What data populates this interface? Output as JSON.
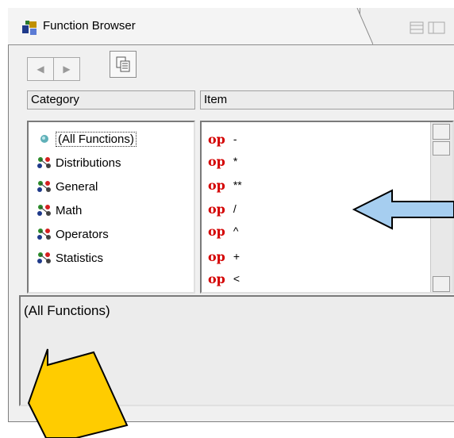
{
  "window": {
    "title": "Function Browser"
  },
  "toolbar": {
    "back_icon": "arrow-left-icon",
    "forward_icon": "arrow-right-icon",
    "copy_icon": "copy-icon"
  },
  "columns": {
    "category": "Category",
    "item": "Item"
  },
  "categories": [
    {
      "label": "(All Functions)",
      "icon": "dot-icon",
      "selected": true
    },
    {
      "label": "Distributions",
      "icon": "function-group-icon"
    },
    {
      "label": "General",
      "icon": "function-group-icon"
    },
    {
      "label": "Math",
      "icon": "function-group-icon"
    },
    {
      "label": "Operators",
      "icon": "function-group-icon"
    },
    {
      "label": "Statistics",
      "icon": "function-group-icon"
    }
  ],
  "items": [
    {
      "tag": "op",
      "symbol": "-"
    },
    {
      "tag": "op",
      "symbol": "*"
    },
    {
      "tag": "op",
      "symbol": "**"
    },
    {
      "tag": "op",
      "symbol": "/"
    },
    {
      "tag": "op",
      "symbol": "^"
    },
    {
      "tag": "op",
      "symbol": "+"
    },
    {
      "tag": "op",
      "symbol": "<"
    }
  ],
  "description": {
    "text": "(All Functions)"
  },
  "annotations": {
    "blue_arrow_color": "#a6cef0",
    "yellow_arrow_color": "#ffcc00"
  }
}
